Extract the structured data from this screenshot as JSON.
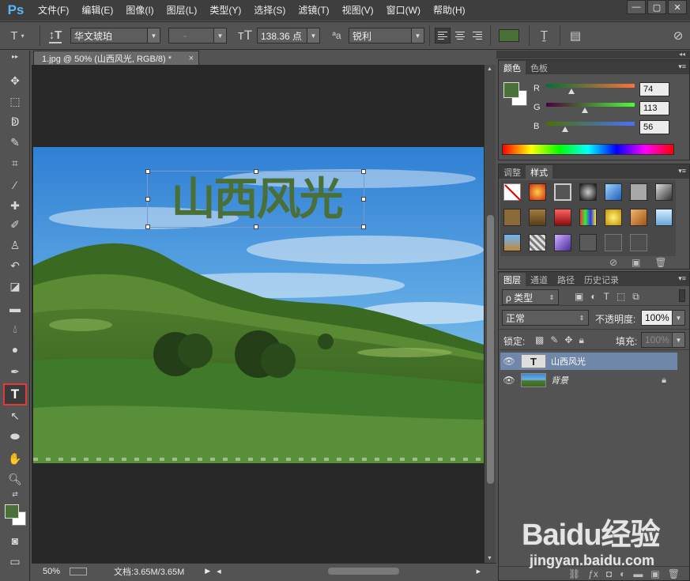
{
  "app": {
    "logo": "Ps"
  },
  "menu": [
    "文件(F)",
    "编辑(E)",
    "图像(I)",
    "图层(L)",
    "类型(Y)",
    "选择(S)",
    "滤镜(T)",
    "视图(V)",
    "窗口(W)",
    "帮助(H)"
  ],
  "window_controls": {
    "minimize": "—",
    "restore": "▢",
    "close": "✕"
  },
  "options": {
    "font_family": "华文琥珀",
    "font_style": "-",
    "font_size": "138.36 点",
    "aa_label": "ªa",
    "antialias": "锐利",
    "text_color": "#4a7038"
  },
  "document": {
    "tab_title": "1.jpg @ 50% (山西风光, RGB/8) *",
    "tab_close": "×",
    "text_layer_content": "山西风光",
    "zoom": "50%",
    "doc_info": "文档:3.65M/3.65M"
  },
  "color_panel": {
    "tabs": [
      "颜色",
      "色板"
    ],
    "labels": [
      "R",
      "G",
      "B"
    ],
    "r": "74",
    "g": "113",
    "b": "56",
    "foreground": "#4a7138",
    "background": "#ffffff"
  },
  "styles_panel": {
    "tabs": [
      "调整",
      "样式"
    ]
  },
  "layers_panel": {
    "tabs": [
      "图层",
      "通道",
      "路径",
      "历史记录"
    ],
    "filter_kind": "ρ 类型",
    "blend_mode": "正常",
    "opacity_label": "不透明度:",
    "opacity_value": "100%",
    "lock_label": "锁定:",
    "fill_label": "填充:",
    "fill_value": "100%",
    "layers": [
      {
        "name": "山西风光",
        "type": "T"
      },
      {
        "name": "背景",
        "type": "image"
      }
    ]
  },
  "watermark": {
    "text": "Baidu经验",
    "url": "jingyan.baidu.com"
  }
}
